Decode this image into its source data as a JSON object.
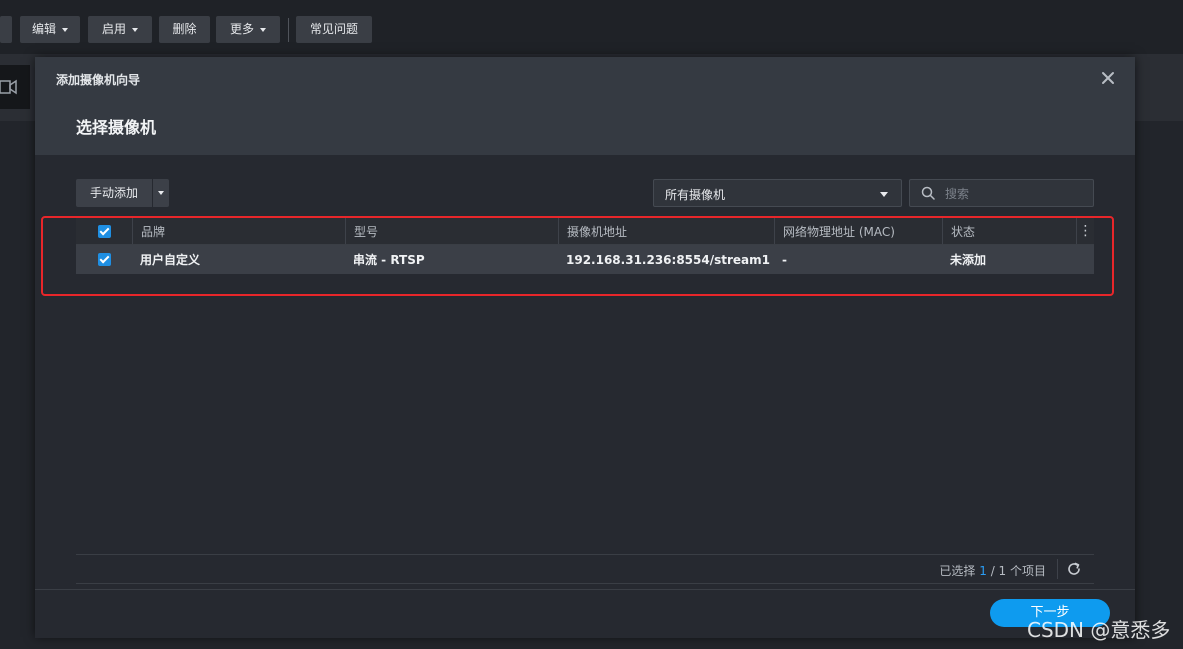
{
  "toolbar": {
    "edit_label": "编辑",
    "enable_label": "启用",
    "delete_label": "删除",
    "more_label": "更多",
    "faq_label": "常见问题"
  },
  "dialog": {
    "window_title": "添加摄像机向导",
    "step_title": "选择摄像机",
    "manual_add_label": "手动添加",
    "filter_value": "所有摄像机",
    "search_placeholder": "搜索",
    "table": {
      "columns": [
        "品牌",
        "型号",
        "摄像机地址",
        "网络物理地址 (MAC)",
        "状态"
      ],
      "rows": [
        {
          "brand": "用户自定义",
          "model": "串流 - RTSP",
          "address": "192.168.31.236:8554/stream1",
          "mac": "-",
          "status": "未添加",
          "checked": true
        }
      ]
    },
    "footer": {
      "selected_prefix": "已选择 ",
      "selected_count": "1",
      "selected_suffix": " / 1 个项目"
    },
    "next_label": "下一步"
  },
  "watermark": "CSDN @意悉多",
  "colors": {
    "accent": "#0e9bef",
    "checkbox": "#1f8fe3",
    "highlight_border": "#e8262a"
  }
}
